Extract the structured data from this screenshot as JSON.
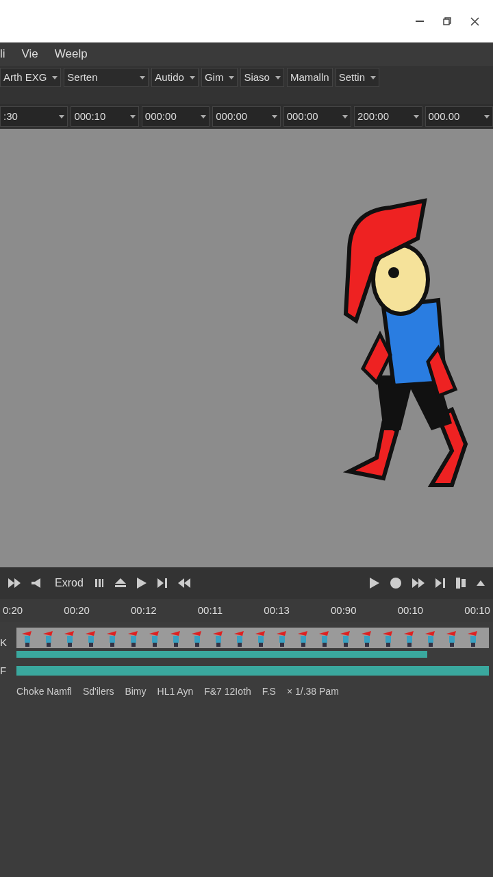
{
  "menu": [
    "li",
    "Vie",
    "Weelp"
  ],
  "toolbar": [
    {
      "label": "Arth EXG",
      "dropdown": true
    },
    {
      "label": "Serten",
      "dropdown": true
    },
    {
      "label": "Autido",
      "dropdown": true
    },
    {
      "label": "Gim",
      "dropdown": true
    },
    {
      "label": "Siaso",
      "dropdown": true
    },
    {
      "label": "Mamalln",
      "dropdown": false
    },
    {
      "label": "Settin",
      "dropdown": true
    }
  ],
  "time_fields": [
    ":30",
    "000:10",
    "000:00",
    "000:00",
    "000:00",
    "200:00",
    "000.00"
  ],
  "transport": {
    "label": "Exrod"
  },
  "ruler": [
    "0:20",
    "00:20",
    "00:12",
    "00:11",
    "00:13",
    "00:90",
    "00:10",
    "00:10"
  ],
  "track_headers": [
    "K",
    "F"
  ],
  "status_texts": [
    "Choke Namfl",
    "Sd'ilers",
    "Bimy",
    "HL1 Ayn",
    "F&7 12Ioth",
    "F.S",
    "× 1/.38 Pam"
  ]
}
